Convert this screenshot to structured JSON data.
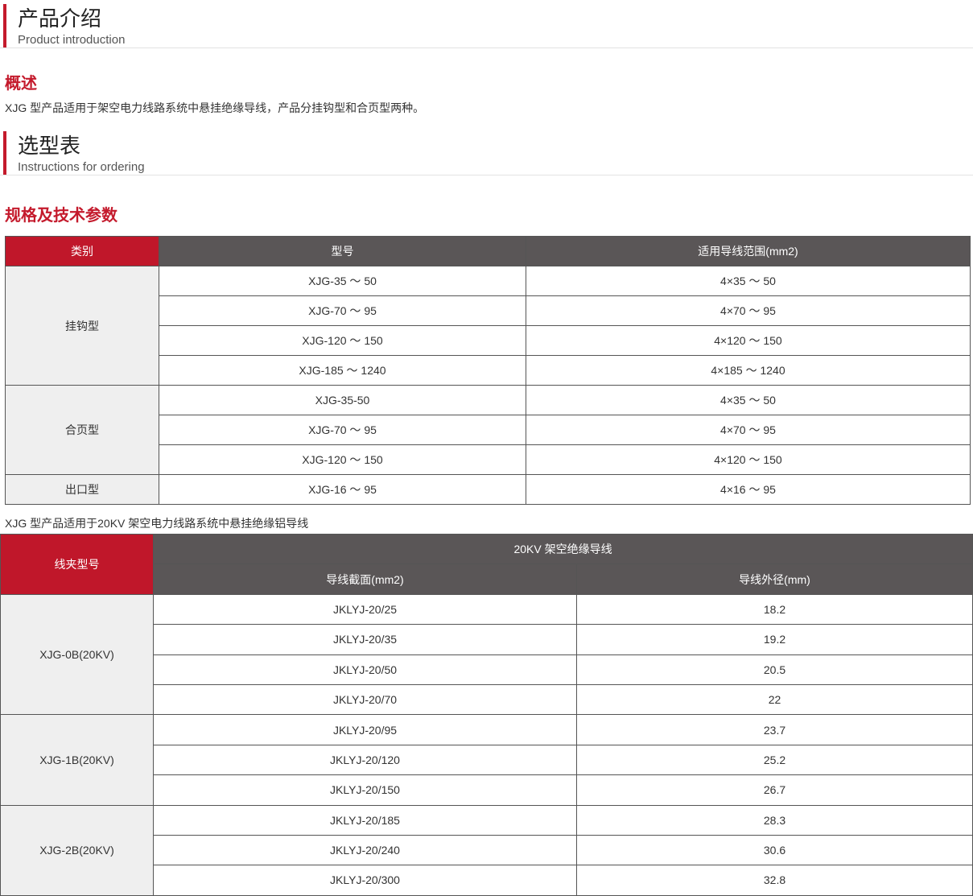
{
  "intro": {
    "title_cn": "产品介绍",
    "title_en": "Product introduction"
  },
  "overview": {
    "heading": "概述",
    "text": "XJG 型产品适用于架空电力线路系统中悬挂绝缘导线，产品分挂钩型和合页型两种。"
  },
  "selection": {
    "title_cn": "选型表",
    "title_en": "Instructions for ordering"
  },
  "spec_heading": "规格及技术参数",
  "table1": {
    "headers": [
      "类别",
      "型号",
      "适用导线范围(mm2)"
    ],
    "groups": [
      {
        "category": "挂钩型",
        "rows": [
          [
            "XJG-35 ～ 50",
            "4×35 ～ 50"
          ],
          [
            "XJG-70 ～ 95",
            "4×70 ～ 95"
          ],
          [
            "XJG-120 ～ 150",
            "4×120 ～ 150"
          ],
          [
            "XJG-185 ～ 1240",
            "4×185 ～ 1240"
          ]
        ]
      },
      {
        "category": "合页型",
        "rows": [
          [
            "XJG-35-50",
            "4×35 ～ 50"
          ],
          [
            "XJG-70 ～ 95",
            "4×70 ～ 95"
          ],
          [
            "XJG-120 ～ 150",
            "4×120 ～ 150"
          ]
        ]
      },
      {
        "category": "出口型",
        "rows": [
          [
            "XJG-16 ～ 95",
            "4×16 ～ 95"
          ]
        ]
      }
    ]
  },
  "note": "XJG 型产品适用于20KV 架空电力线路系统中悬挂绝缘铝导线",
  "table2": {
    "header_model": "线夹型号",
    "header_group": "20KV 架空绝缘导线",
    "header_section": "导线截面(mm2)",
    "header_diameter": "导线外径(mm)",
    "groups": [
      {
        "model": "XJG-0B(20KV)",
        "rows": [
          [
            "JKLYJ-20/25",
            "18.2"
          ],
          [
            "JKLYJ-20/35",
            "19.2"
          ],
          [
            "JKLYJ-20/50",
            "20.5"
          ],
          [
            "JKLYJ-20/70",
            "22"
          ]
        ]
      },
      {
        "model": "XJG-1B(20KV)",
        "rows": [
          [
            "JKLYJ-20/95",
            "23.7"
          ],
          [
            "JKLYJ-20/120",
            "25.2"
          ],
          [
            "JKLYJ-20/150",
            "26.7"
          ]
        ]
      },
      {
        "model": "XJG-2B(20KV)",
        "rows": [
          [
            "JKLYJ-20/185",
            "28.3"
          ],
          [
            "JKLYJ-20/240",
            "30.6"
          ],
          [
            "JKLYJ-20/300",
            "32.8"
          ]
        ]
      }
    ]
  },
  "colors": {
    "accent": "#c0172a",
    "header_dark": "#5a5657",
    "category_bg": "#efefef"
  }
}
